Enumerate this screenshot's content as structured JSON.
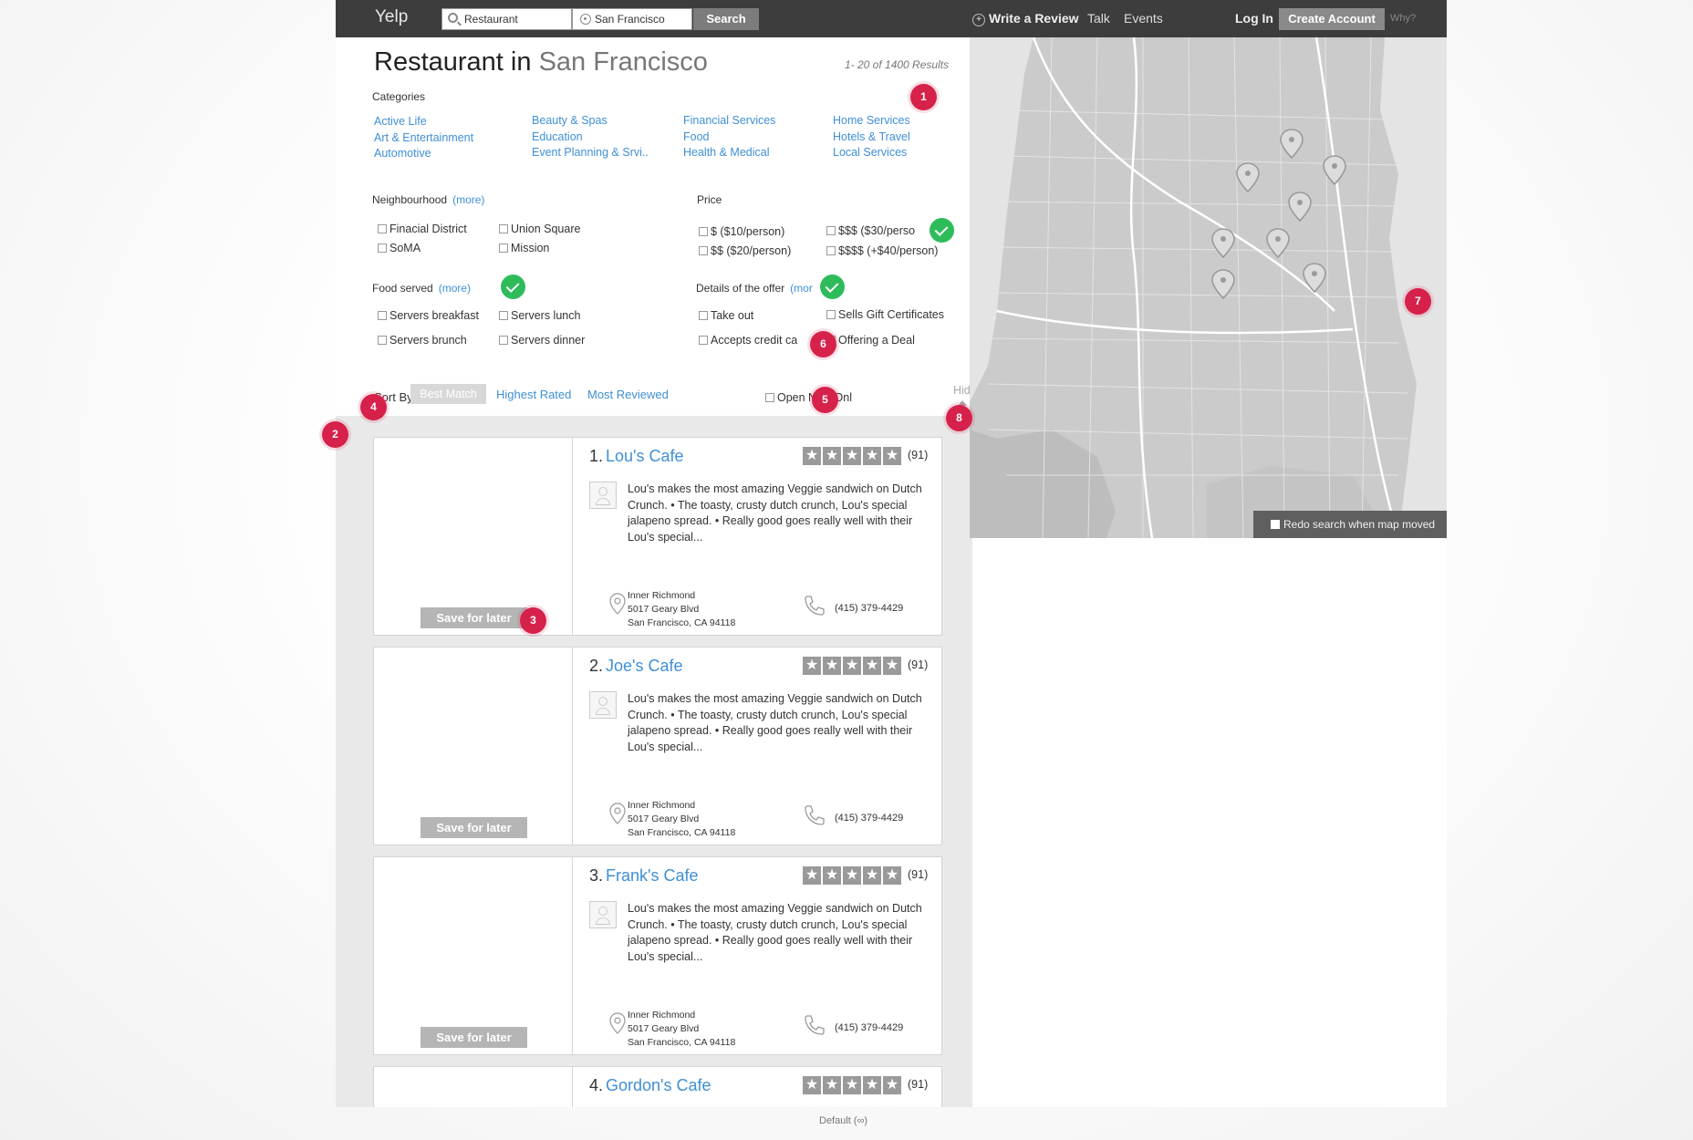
{
  "header": {
    "logo": "Yelp",
    "search_value": "Restaurant",
    "location_value": "San Francisco",
    "search_button": "Search",
    "write_review": "Write a Review",
    "talk": "Talk",
    "events": "Events",
    "login": "Log In",
    "create_account": "Create Account",
    "why": "Why?"
  },
  "page": {
    "title_prefix": "Restaurant in",
    "title_location": "San Francisco",
    "results_count": "1- 20 of 1400 Results"
  },
  "filters": {
    "categories_label": "Categories",
    "categories_col1": [
      "Active Life",
      "Art & Entertainment",
      "Automotive"
    ],
    "categories_col2": [
      "Beauty & Spas",
      "Education",
      "Event Planning & Srvi.."
    ],
    "categories_col3": [
      "Financial Services",
      "Food",
      "Health & Medical"
    ],
    "categories_col4": [
      "Home Services",
      "Hotels & Travel",
      "Local Services"
    ],
    "neighbourhood_label": "Neighbourhood",
    "more": "(more)",
    "more_truncated": "(mor",
    "neighbourhoods": [
      "Finacial District",
      "Union Square",
      "SoMA",
      "Mission"
    ],
    "price_label": "Price",
    "prices": [
      "$ ($10/person)",
      "$$$ ($30/perso",
      "$$ ($20/person)",
      "$$$$ (+$40/person)"
    ],
    "food_label": "Food served",
    "foods": [
      "Servers breakfast",
      "Servers lunch",
      "Servers brunch",
      "Servers dinner"
    ],
    "offer_label": "Details of the offer",
    "offers": [
      "Take out",
      "Sells Gift Certificates",
      "Accepts credit ca",
      "Offering a Deal"
    ]
  },
  "sort": {
    "label": "Sort By:",
    "options": [
      "Best Match",
      "Highest Rated",
      "Most Reviewed"
    ],
    "open_now": "Open Now Onl",
    "hide": "Hide"
  },
  "results": [
    {
      "num": "1.",
      "name": "Lou's Cafe",
      "reviews": "(91)",
      "rating": 5
    },
    {
      "num": "2.",
      "name": "Joe's Cafe",
      "reviews": "(91)",
      "rating": 5
    },
    {
      "num": "3.",
      "name": "Frank's Cafe",
      "reviews": "(91)",
      "rating": 5
    },
    {
      "num": "4.",
      "name": "Gordon's Cafe",
      "reviews": "(91)",
      "rating": 5
    }
  ],
  "result_common": {
    "snippet": "Lou's makes the most amazing Veggie sandwich on Dutch Crunch. • The toasty, crusty dutch crunch, Lou's special jalapeno spread. • Really good goes really well with their Lou's special...",
    "address_line1": "Inner Richmond",
    "address_line2": "5017 Geary Blvd",
    "address_line3": "San Francisco, CA 94118",
    "phone": "(415) 379-4429",
    "save_label": "Save for later"
  },
  "map": {
    "redo_label": "Redo search when map moved"
  },
  "annotations": [
    "1",
    "2",
    "3",
    "4",
    "5",
    "6",
    "7",
    "8"
  ],
  "footer": "Default (∞)",
  "colors": {
    "link": "#3f8fd6",
    "topbar": "#3d3d3d",
    "badge_red": "#d6214b",
    "badge_green": "#2ebc5a"
  }
}
